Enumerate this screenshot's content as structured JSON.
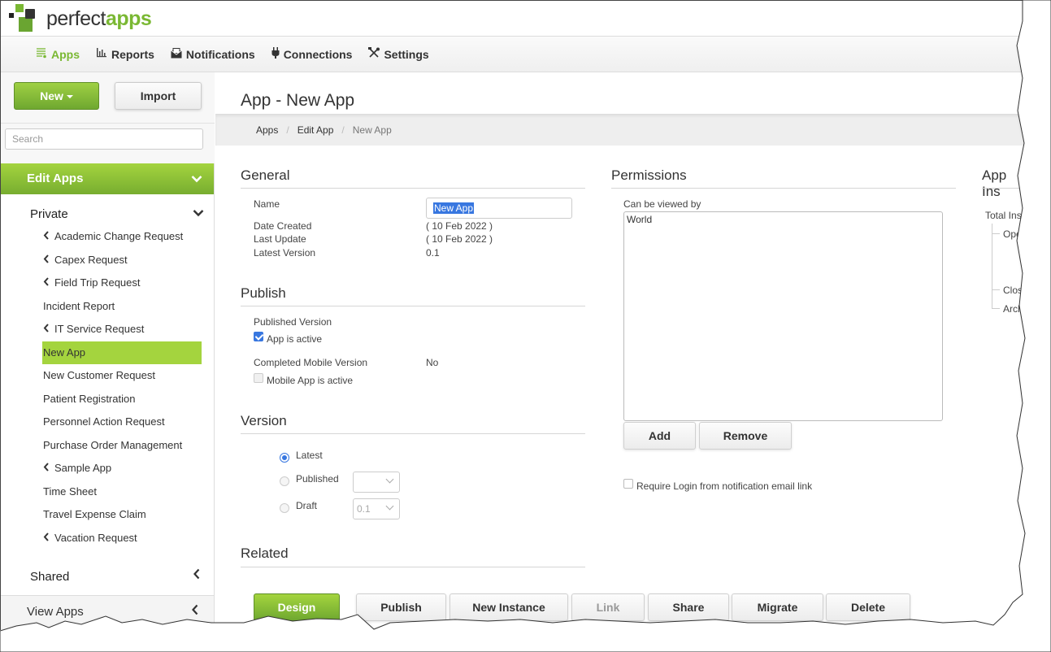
{
  "brand": {
    "name_part1": "perfect",
    "name_part2": "apps"
  },
  "nav": {
    "items": [
      {
        "label": "Apps",
        "icon": "apps-list-icon",
        "active": true
      },
      {
        "label": "Reports",
        "icon": "bar-chart-icon",
        "active": false
      },
      {
        "label": "Notifications",
        "icon": "envelope-icon",
        "active": false
      },
      {
        "label": "Connections",
        "icon": "plug-icon",
        "active": false
      },
      {
        "label": "Settings",
        "icon": "tools-icon",
        "active": false
      }
    ]
  },
  "sidebar": {
    "new_label": "New",
    "import_label": "Import",
    "search_placeholder": "Search",
    "edit_apps_label": "Edit Apps",
    "private_label": "Private",
    "items": [
      {
        "label": "Academic Change Request",
        "expandable": true,
        "active": false
      },
      {
        "label": "Capex Request",
        "expandable": true,
        "active": false
      },
      {
        "label": "Field Trip Request",
        "expandable": true,
        "active": false
      },
      {
        "label": "Incident Report",
        "expandable": false,
        "active": false
      },
      {
        "label": "IT Service Request",
        "expandable": true,
        "active": false
      },
      {
        "label": "New App",
        "expandable": false,
        "active": true
      },
      {
        "label": "New Customer Request",
        "expandable": false,
        "active": false
      },
      {
        "label": "Patient Registration",
        "expandable": false,
        "active": false
      },
      {
        "label": "Personnel Action Request",
        "expandable": false,
        "active": false
      },
      {
        "label": "Purchase Order Management",
        "expandable": false,
        "active": false
      },
      {
        "label": "Sample App",
        "expandable": true,
        "active": false
      },
      {
        "label": "Time Sheet",
        "expandable": false,
        "active": false
      },
      {
        "label": "Travel Expense Claim",
        "expandable": false,
        "active": false
      },
      {
        "label": "Vacation Request",
        "expandable": true,
        "active": false
      }
    ],
    "shared_label": "Shared",
    "view_apps_label": "View Apps"
  },
  "page": {
    "title": "App - New App",
    "breadcrumb": [
      "Apps",
      "Edit App",
      "New App"
    ]
  },
  "general": {
    "title": "General",
    "name_label": "Name",
    "name_value": "New App",
    "date_created_label": "Date Created",
    "date_created_value": "( 10 Feb 2022 )",
    "last_update_label": "Last Update",
    "last_update_value": "( 10 Feb 2022 )",
    "latest_version_label": "Latest Version",
    "latest_version_value": "0.1"
  },
  "publish": {
    "title": "Publish",
    "published_version_label": "Published Version",
    "app_active_label": "App is active",
    "app_active_checked": true,
    "completed_mobile_label": "Completed Mobile Version",
    "completed_mobile_value": "No",
    "mobile_active_label": "Mobile App is active",
    "mobile_active_checked": false
  },
  "version": {
    "title": "Version",
    "options": [
      {
        "label": "Latest",
        "checked": true
      },
      {
        "label": "Published",
        "checked": false,
        "select_value": ""
      },
      {
        "label": "Draft",
        "checked": false,
        "select_value": "0.1"
      }
    ]
  },
  "related": {
    "title": "Related"
  },
  "permissions": {
    "title": "Permissions",
    "can_view_label": "Can be viewed by",
    "viewers": [
      "World"
    ],
    "add_label": "Add",
    "remove_label": "Remove",
    "require_login_label": "Require Login from notification email link",
    "require_login_checked": false
  },
  "instances": {
    "title": "App Ins",
    "total_label": "Total Ins",
    "open_label": "Open",
    "closed_label": "Close",
    "archived_label": "Archi"
  },
  "actions": {
    "design": "Design",
    "publish": "Publish",
    "new_instance": "New Instance",
    "link": "Link",
    "share": "Share",
    "migrate": "Migrate",
    "delete": "Delete"
  },
  "colors": {
    "brand_green": "#7ab833",
    "active_item": "#a4d43e",
    "selection_blue": "#3877e0"
  }
}
